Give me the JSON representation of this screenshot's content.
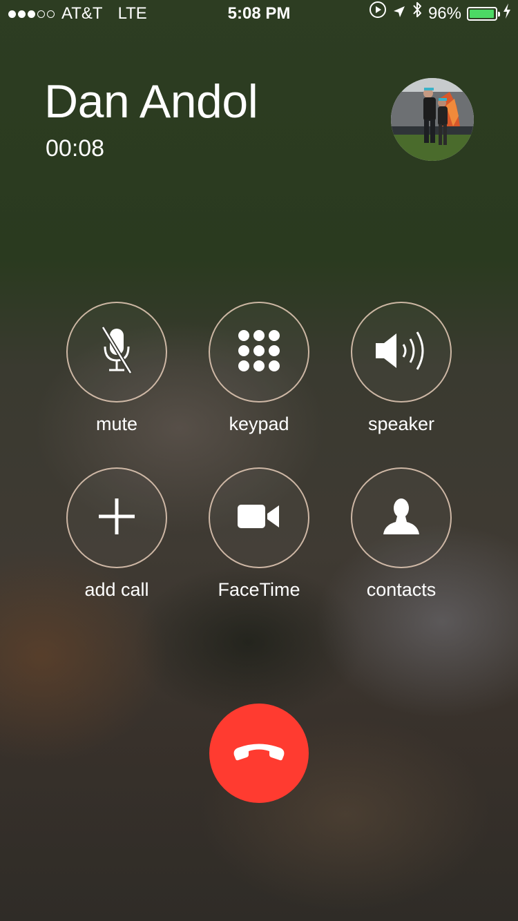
{
  "status_bar": {
    "signal_bars": 5,
    "signal_filled": 3,
    "carrier": "AT&T",
    "network": "LTE",
    "time": "5:08 PM",
    "battery_percent": "96%",
    "battery_level": 0.96,
    "battery_color": "#4cd964",
    "icons": [
      "play-icon",
      "location-arrow-icon",
      "bluetooth-icon",
      "charging-bolt-icon"
    ]
  },
  "call": {
    "caller_name": "Dan Andol",
    "duration": "00:08"
  },
  "controls": [
    {
      "label": "mute",
      "icon": "microphone-off-icon"
    },
    {
      "label": "keypad",
      "icon": "keypad-icon"
    },
    {
      "label": "speaker",
      "icon": "speaker-icon"
    },
    {
      "label": "add call",
      "icon": "plus-icon"
    },
    {
      "label": "FaceTime",
      "icon": "video-camera-icon"
    },
    {
      "label": "contacts",
      "icon": "person-icon"
    }
  ],
  "end_call": {
    "icon": "phone-hangup-icon",
    "color": "#ff3b30"
  }
}
